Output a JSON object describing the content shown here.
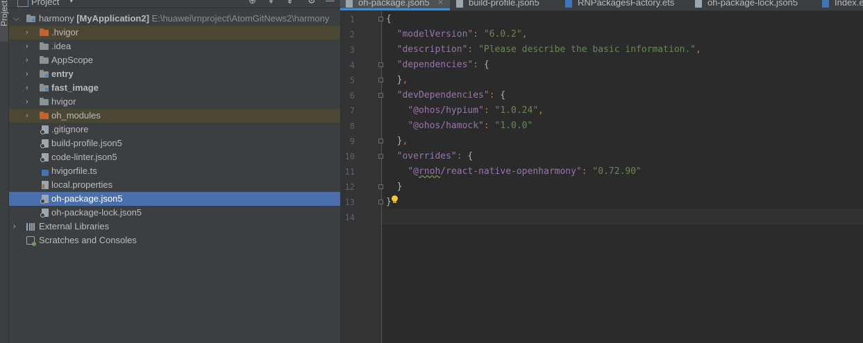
{
  "sidebar_strip": {
    "label": "Project"
  },
  "project_panel": {
    "title": "Project",
    "dropdown_glyph": "▾",
    "header_buttons": [
      {
        "name": "locate-icon",
        "glyph": "⊕"
      },
      {
        "name": "expand-all-icon",
        "glyph": "⇞"
      },
      {
        "name": "collapse-all-icon",
        "glyph": "⇟"
      },
      {
        "name": "settings-icon",
        "glyph": "⚙"
      },
      {
        "name": "hide-icon",
        "glyph": "—"
      }
    ],
    "root": {
      "name": "harmony",
      "module": "[MyApplication2]",
      "path": "E:\\huawei\\rnproject\\AtomGitNews2\\harmony"
    },
    "items": [
      {
        "label": ".hvigor",
        "icon": "folder-orange",
        "expandable": true,
        "bold": false
      },
      {
        "label": ".idea",
        "icon": "folder-gray",
        "expandable": true,
        "bold": false
      },
      {
        "label": "AppScope",
        "icon": "folder-gray",
        "expandable": true,
        "bold": false
      },
      {
        "label": "entry",
        "icon": "module-folder",
        "expandable": true,
        "bold": true
      },
      {
        "label": "fast_image",
        "icon": "module-folder",
        "expandable": true,
        "bold": true
      },
      {
        "label": "hvigor",
        "icon": "folder-gray",
        "expandable": true,
        "bold": false
      },
      {
        "label": "oh_modules",
        "icon": "folder-orange",
        "expandable": true,
        "bold": false
      },
      {
        "label": ".gitignore",
        "icon": "file-ignore",
        "expandable": false,
        "bold": false
      },
      {
        "label": "build-profile.json5",
        "icon": "file-json",
        "expandable": false,
        "bold": false
      },
      {
        "label": "code-linter.json5",
        "icon": "file-json",
        "expandable": false,
        "bold": false
      },
      {
        "label": "hvigorfile.ts",
        "icon": "file-ts",
        "expandable": false,
        "bold": false
      },
      {
        "label": "local.properties",
        "icon": "file-properties",
        "expandable": false,
        "bold": false
      },
      {
        "label": "oh-package.json5",
        "icon": "file-json",
        "expandable": false,
        "bold": false
      },
      {
        "label": "oh-package-lock.json5",
        "icon": "file-json",
        "expandable": false,
        "bold": false
      }
    ],
    "external_libraries": "External Libraries",
    "scratches": "Scratches and Consoles"
  },
  "editor": {
    "tabs": [
      {
        "label": "oh-package.json5",
        "active": true
      },
      {
        "label": "build-profile.json5",
        "active": false
      },
      {
        "label": "RNPackagesFactory.ets",
        "active": false
      },
      {
        "label": "oh-package-lock.json5",
        "active": false
      },
      {
        "label": "Index.e",
        "active": false
      }
    ],
    "close_glyph": "×",
    "line_numbers": [
      "1",
      "2",
      "3",
      "4",
      "5",
      "6",
      "7",
      "8",
      "9",
      "10",
      "11",
      "12",
      "13",
      "14"
    ],
    "code": {
      "l1": "{",
      "l2_key": "\"modelVersion\"",
      "l2_val": "\"6.0.2\"",
      "l3_key": "\"description\"",
      "l3_val": "\"Please describe the basic information.\"",
      "l4_key": "\"dependencies\"",
      "l6_key": "\"devDependencies\"",
      "l7_key": "\"@ohos/hypium\"",
      "l7_val": "\"1.0.24\"",
      "l8_key": "\"@ohos/hamock\"",
      "l8_val": "\"1.0.0\"",
      "l10_key": "\"overrides\"",
      "l11_key_a": "\"@",
      "l11_key_b": "rnoh",
      "l11_key_c": "/react-native-openharmony\"",
      "l11_val": "\"0.72.90\"",
      "colon": ": ",
      "comma": ",",
      "open": "{",
      "close": "}"
    }
  },
  "colors": {
    "panel_bg": "#3c3f41",
    "editor_bg": "#2b2b2b",
    "selection": "#4b6eaf",
    "json_key": "#9876aa",
    "json_string": "#6a8759",
    "punctuation": "#cc7832"
  }
}
